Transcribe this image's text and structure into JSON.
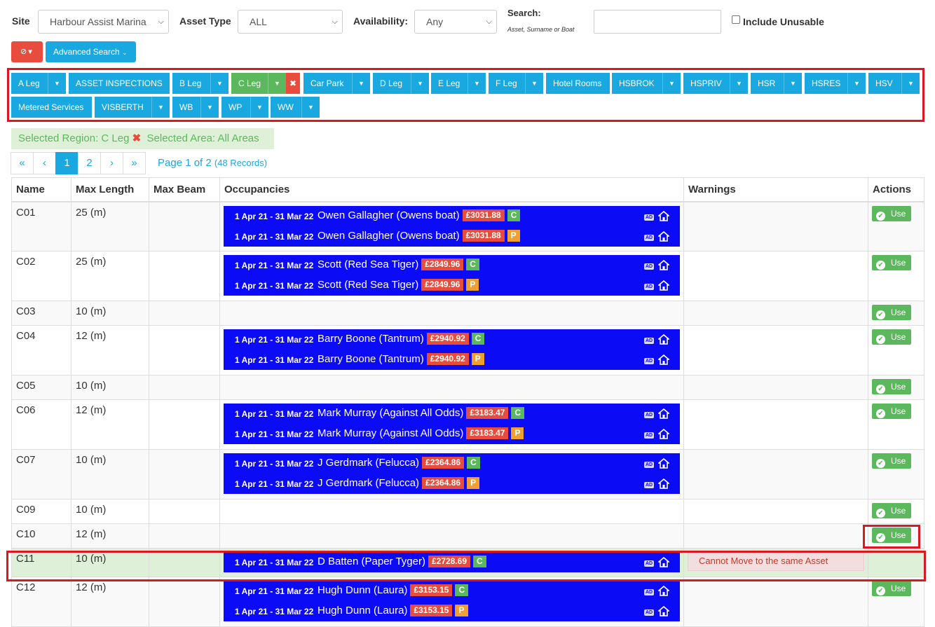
{
  "filters": {
    "site_label": "Site",
    "site_value": "Harbour Assist Marina",
    "asset_type_label": "Asset Type",
    "asset_type_value": "ALL",
    "availability_label": "Availability:",
    "availability_value": "Any",
    "search_label": "Search:",
    "search_hint": "Asset, Surname or Boat",
    "search_value": "",
    "include_unusable_label": "Include Unusable",
    "advanced_search_label": "Advanced Search"
  },
  "regions": [
    "A Leg",
    "ASSET INSPECTIONS",
    "B Leg",
    "C Leg",
    "Car Park",
    "D Leg",
    "E Leg",
    "F Leg",
    "Hotel Rooms",
    "HSBROK",
    "HSPRIV",
    "HSR",
    "HSRES",
    "HSV",
    "Metered Services",
    "VISBERTH",
    "WB",
    "WP",
    "WW"
  ],
  "selection": {
    "region_text": "Selected Region: C Leg",
    "area_text": "Selected Area: All Areas"
  },
  "pagination": {
    "first": "«",
    "prev": "‹",
    "next": "›",
    "last": "»",
    "pages": [
      "1",
      "2"
    ],
    "current": "1",
    "info": "Page 1 of 2",
    "records": "(48 Records)"
  },
  "table": {
    "headers": [
      "Name",
      "Max Length",
      "Max Beam",
      "Occupancies",
      "Warnings",
      "Actions"
    ],
    "use_label": "Use",
    "rows": [
      {
        "name": "C01",
        "length": "25 (m)",
        "occ": [
          {
            "dates": "1 Apr 21 - 31 Mar 22",
            "who": "Owen Gallagher (Owens boat)",
            "price": "£3031.88",
            "tag": "C"
          },
          {
            "dates": "1 Apr 21 - 31 Mar 22",
            "who": "Owen Gallagher (Owens boat)",
            "price": "£3031.88",
            "tag": "P"
          }
        ]
      },
      {
        "name": "C02",
        "length": "25 (m)",
        "occ": [
          {
            "dates": "1 Apr 21 - 31 Mar 22",
            "who": "Scott (Red Sea Tiger)",
            "price": "£2849.96",
            "tag": "C"
          },
          {
            "dates": "1 Apr 21 - 31 Mar 22",
            "who": "Scott (Red Sea Tiger)",
            "price": "£2849.96",
            "tag": "P"
          }
        ]
      },
      {
        "name": "C03",
        "length": "10 (m)",
        "occ": []
      },
      {
        "name": "C04",
        "length": "12 (m)",
        "occ": [
          {
            "dates": "1 Apr 21 - 31 Mar 22",
            "who": "Barry Boone (Tantrum)",
            "price": "£2940.92",
            "tag": "C"
          },
          {
            "dates": "1 Apr 21 - 31 Mar 22",
            "who": "Barry Boone (Tantrum)",
            "price": "£2940.92",
            "tag": "P"
          }
        ]
      },
      {
        "name": "C05",
        "length": "10 (m)",
        "occ": []
      },
      {
        "name": "C06",
        "length": "12 (m)",
        "occ": [
          {
            "dates": "1 Apr 21 - 31 Mar 22",
            "who": "Mark Murray (Against All Odds)",
            "price": "£3183.47",
            "tag": "C"
          },
          {
            "dates": "1 Apr 21 - 31 Mar 22",
            "who": "Mark Murray (Against All Odds)",
            "price": "£3183.47",
            "tag": "P"
          }
        ]
      },
      {
        "name": "C07",
        "length": "10 (m)",
        "occ": [
          {
            "dates": "1 Apr 21 - 31 Mar 22",
            "who": "J Gerdmark (Felucca)",
            "price": "£2364.86",
            "tag": "C"
          },
          {
            "dates": "1 Apr 21 - 31 Mar 22",
            "who": "J Gerdmark (Felucca)",
            "price": "£2364.86",
            "tag": "P"
          }
        ]
      },
      {
        "name": "C09",
        "length": "10 (m)",
        "occ": []
      },
      {
        "name": "C10",
        "length": "12 (m)",
        "occ": []
      },
      {
        "name": "C11",
        "length": "10 (m)",
        "occ": [
          {
            "dates": "1 Apr 21 - 31 Mar 22",
            "who": "D Batten (Paper Tyger)",
            "price": "£2728.69",
            "tag": "C"
          }
        ],
        "warning": "Cannot Move to the same Asset",
        "no_action": true
      },
      {
        "name": "C12",
        "length": "12 (m)",
        "occ": [
          {
            "dates": "1 Apr 21 - 31 Mar 22",
            "who": "Hugh Dunn (Laura)",
            "price": "£3153.15",
            "tag": "C"
          },
          {
            "dates": "1 Apr 21 - 31 Mar 22",
            "who": "Hugh Dunn (Laura)",
            "price": "£3153.15",
            "tag": "P"
          }
        ]
      }
    ]
  },
  "colors": {
    "primary": "#1aa8e0",
    "success": "#5cb85c",
    "danger": "#e74c3c",
    "occupancy": "#0b0bf5",
    "warning_tag": "#f0a030"
  }
}
